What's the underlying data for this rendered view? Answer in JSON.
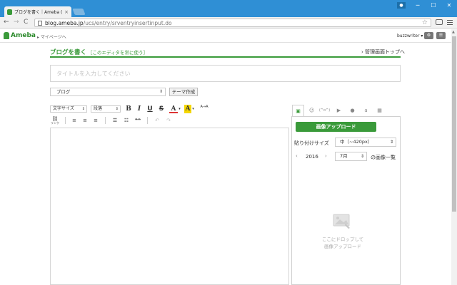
{
  "browser": {
    "tab_title": "ブログを書く｜Ameba (アメ",
    "tab_close": "×",
    "url_host": "blog.ameba.jp",
    "url_path": "/ucs/entry/srventryinsertinput.do",
    "window_min": "─",
    "window_max": "☐",
    "window_close": "✕",
    "back": "←",
    "forward": "→",
    "reload": "C",
    "star": "☆"
  },
  "header": {
    "logo": "Ameba",
    "mypage": "▸ マイページへ",
    "username": "buzzwriter ▾",
    "gear": "⚙",
    "menu": "☰"
  },
  "page": {
    "title": "ブログを書く",
    "editor_switch": "［このエディタを常に使う］",
    "admin_top": "› 管理画面トップへ",
    "title_placeholder": "タイトルを入力してください",
    "theme_value": "ブログ",
    "theme_button": "テーマ作成"
  },
  "toolbar": {
    "font_size": "文字サイズ",
    "paragraph": "段落",
    "bold": "B",
    "italic": "I",
    "underline": "U",
    "strike": "S",
    "text_color": "A",
    "bg_color": "A",
    "clear_format": "A→A",
    "link_icon": "⛓",
    "link_label": "リンク",
    "quote": "❝❝",
    "undo": "↶",
    "redo": "↷"
  },
  "side": {
    "upload_button": "画像アップロード",
    "paste_size_label": "貼り付けサイズ",
    "size_value": "中（~420px）",
    "prev": "‹",
    "year": "2016",
    "next": "›",
    "month_value": "7月",
    "list_label": "の画像一覧",
    "drop_line1": "ここにドロップして",
    "drop_line2": "画像アップロード"
  }
}
